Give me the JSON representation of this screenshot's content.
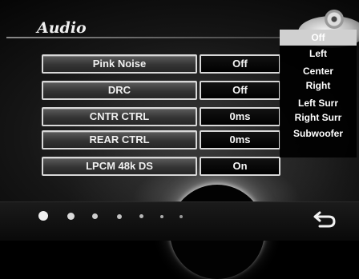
{
  "header": {
    "title": "Audio"
  },
  "settings": [
    {
      "label": "Pink Noise",
      "value": "Off"
    },
    {
      "label": "DRC",
      "value": "Off"
    },
    {
      "label": "CNTR CTRL",
      "value": "0ms"
    },
    {
      "label": "REAR CTRL",
      "value": "0ms"
    },
    {
      "label": "LPCM 48k DS",
      "value": "On"
    }
  ],
  "dropdown": {
    "selected": "Off",
    "options": [
      "Off",
      "Left",
      "Center",
      "Right",
      "Left Surr",
      "Right Surr",
      "Subwoofer"
    ]
  },
  "pager": {
    "page_count": 7,
    "current_page": 1
  },
  "icons": {
    "back": "back-arrow-icon",
    "disc": "disc-logo-icon"
  },
  "colors": {
    "button_border": "#d8d8d8",
    "selected_option": "#d0d0d0"
  }
}
